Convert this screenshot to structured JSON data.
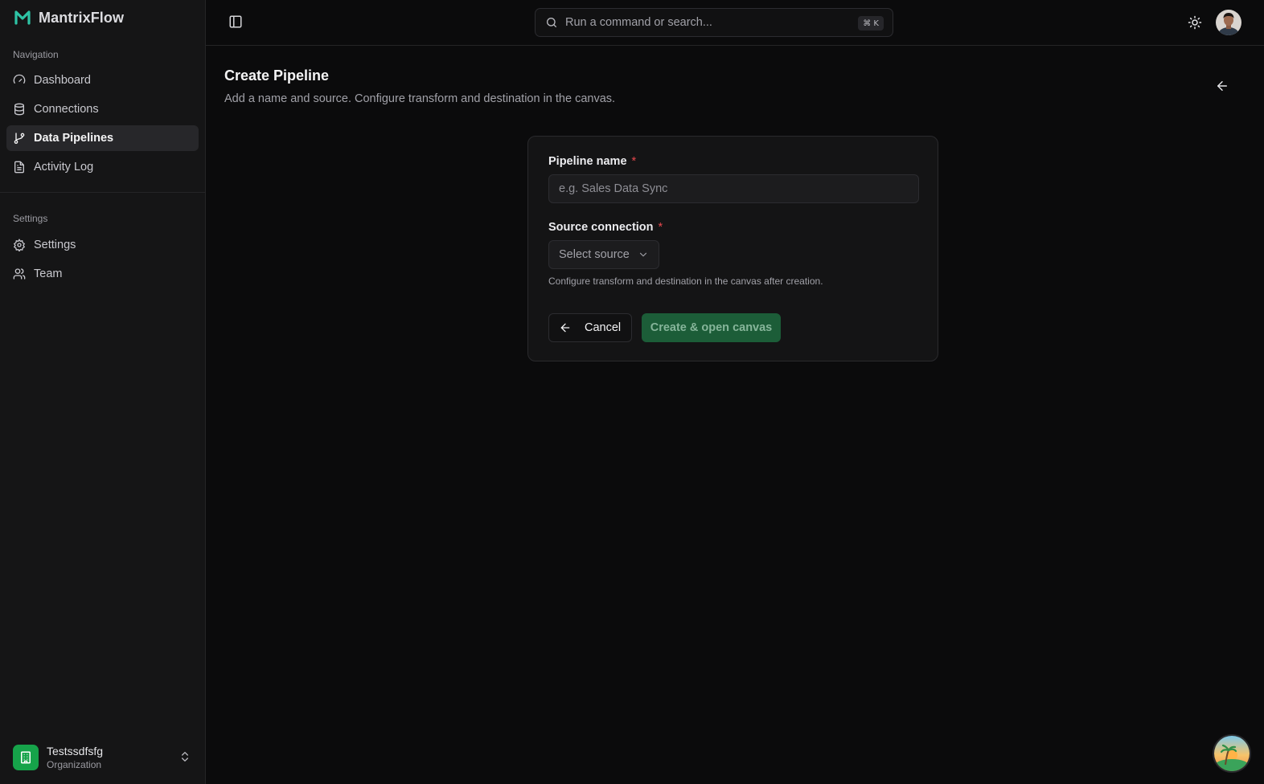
{
  "app": {
    "name": "MantrixFlow"
  },
  "sidebar": {
    "navigation_label": "Navigation",
    "nav_items": [
      {
        "label": "Dashboard",
        "icon": "gauge-icon"
      },
      {
        "label": "Connections",
        "icon": "database-icon"
      },
      {
        "label": "Data Pipelines",
        "icon": "git-branch-icon",
        "active": true
      },
      {
        "label": "Activity Log",
        "icon": "file-text-icon"
      }
    ],
    "settings_label": "Settings",
    "settings_items": [
      {
        "label": "Settings",
        "icon": "gear-icon"
      },
      {
        "label": "Team",
        "icon": "users-icon"
      }
    ],
    "organization": {
      "name": "Testssdfsfg",
      "subtitle": "Organization",
      "color": "#16a34a"
    }
  },
  "topbar": {
    "search_placeholder": "Run a command or search...",
    "shortcut": "⌘ K"
  },
  "page": {
    "title": "Create Pipeline",
    "subtitle": "Add a name and source. Configure transform and destination in the canvas."
  },
  "form": {
    "pipeline_name_label": "Pipeline name",
    "pipeline_name_placeholder": "e.g. Sales Data Sync",
    "pipeline_name_value": "",
    "required_marker": "*",
    "source_label": "Source connection",
    "source_value": "Select source",
    "help_text": "Configure transform and destination in the canvas after creation.",
    "cancel_label": "Cancel",
    "create_label": "Create & open canvas"
  },
  "colors": {
    "accent": "#1c5d38",
    "required": "#e5484d",
    "background": "#0b0b0c"
  }
}
